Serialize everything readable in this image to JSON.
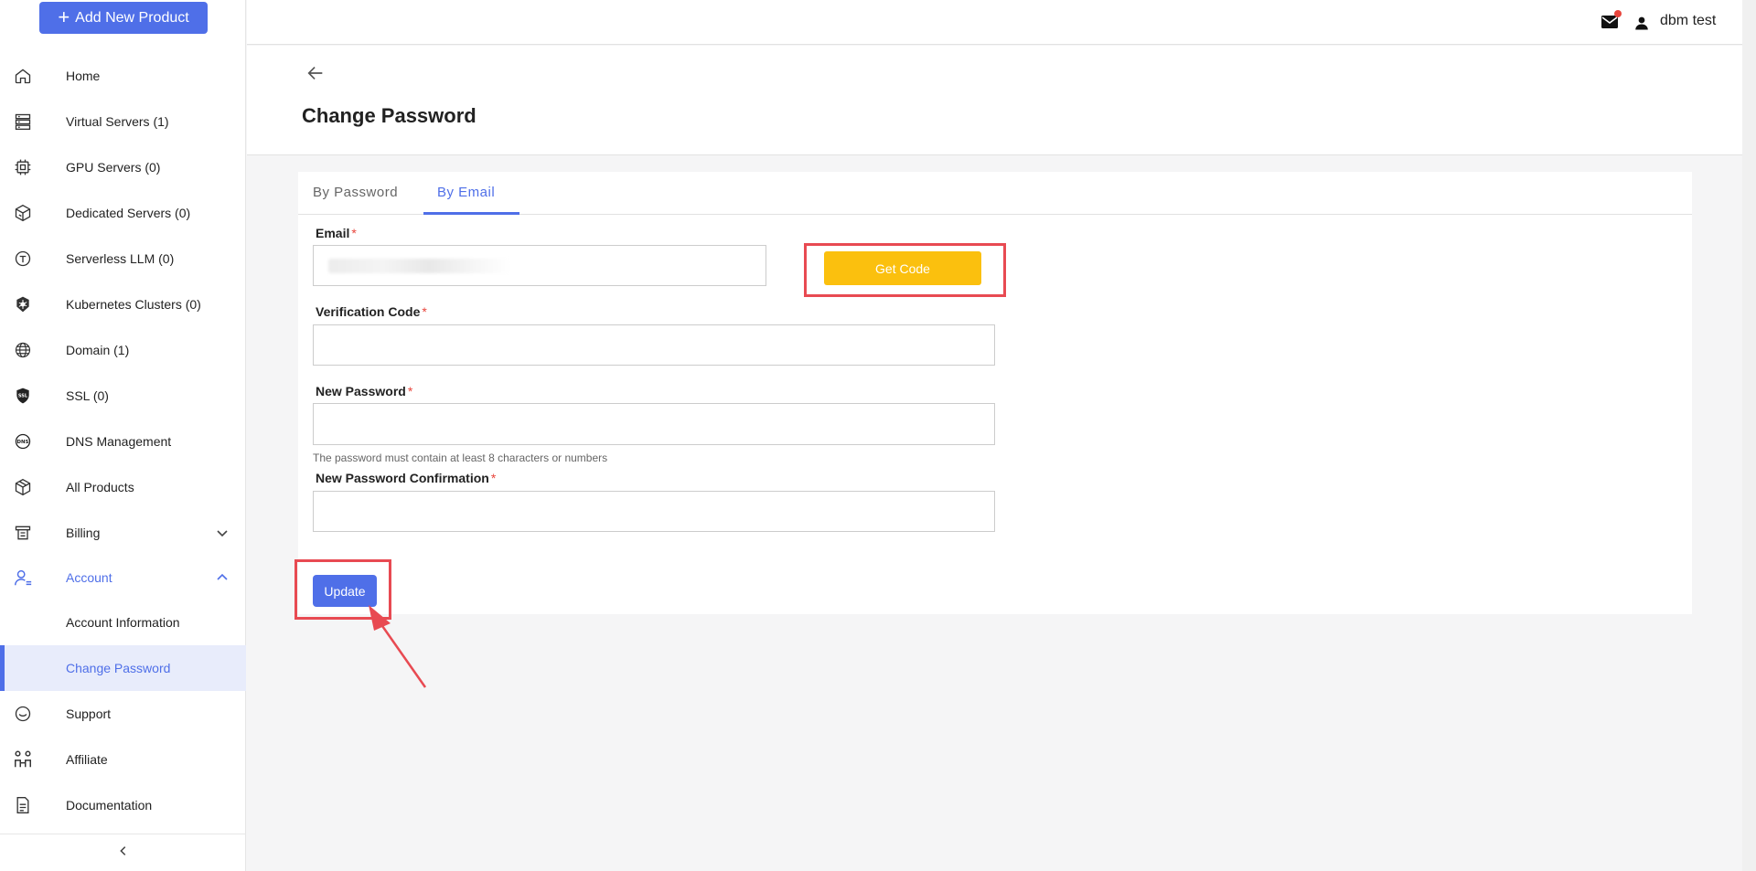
{
  "sidebar": {
    "add_button": "Add New Product",
    "items": [
      {
        "label": "Home",
        "icon": "home-icon"
      },
      {
        "label": "Virtual Servers (1)",
        "icon": "server-icon"
      },
      {
        "label": "GPU Servers (0)",
        "icon": "gpu-icon"
      },
      {
        "label": "Dedicated Servers (0)",
        "icon": "dedicated-server-icon"
      },
      {
        "label": "Serverless LLM (0)",
        "icon": "llm-icon"
      },
      {
        "label": "Kubernetes Clusters (0)",
        "icon": "kubernetes-icon"
      },
      {
        "label": "Domain (1)",
        "icon": "globe-icon"
      },
      {
        "label": "SSL (0)",
        "icon": "ssl-icon"
      },
      {
        "label": "DNS Management",
        "icon": "dns-icon"
      },
      {
        "label": "All Products",
        "icon": "box-icon"
      },
      {
        "label": "Billing",
        "icon": "billing-icon"
      },
      {
        "label": "Account",
        "icon": "account-icon"
      },
      {
        "label": "Account Information"
      },
      {
        "label": "Change Password"
      },
      {
        "label": "Support",
        "icon": "support-icon"
      },
      {
        "label": "Affiliate",
        "icon": "affiliate-icon"
      },
      {
        "label": "Documentation",
        "icon": "document-icon"
      }
    ]
  },
  "header": {
    "user_name": "dbm test"
  },
  "page": {
    "title": "Change Password"
  },
  "tabs": [
    {
      "label": "By Password"
    },
    {
      "label": "By Email"
    }
  ],
  "form": {
    "email_label": "Email",
    "required_mark": "*",
    "get_code": "Get Code",
    "verification_label": "Verification Code",
    "new_password_label": "New Password",
    "password_hint": "The password must contain at least 8 characters or numbers",
    "confirm_label": "New Password Confirmation",
    "update": "Update"
  },
  "colors": {
    "primary": "#4f6fe8",
    "get_code": "#fbc00e",
    "annotation": "#e84a52"
  }
}
